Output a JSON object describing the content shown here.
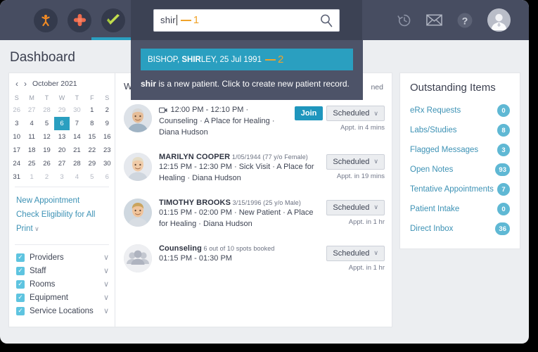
{
  "topbar": {
    "app_icons": [
      {
        "name": "kareo-logo-icon",
        "label": "Kareo"
      },
      {
        "name": "bandage-icon",
        "label": "Clinical"
      },
      {
        "name": "green-check-icon",
        "label": "Billing"
      },
      {
        "name": "heart-patient-icon",
        "label": "Patient Experience"
      }
    ],
    "search": {
      "value": "shir",
      "placeholder": "Search",
      "annotation": "1",
      "icon": "search-icon"
    },
    "right_icons": [
      {
        "name": "history-icon",
        "label": "Recent"
      },
      {
        "name": "mail-icon",
        "label": "Messages"
      },
      {
        "name": "help-icon",
        "label": "Help"
      },
      {
        "name": "user-avatar-icon",
        "label": "Account"
      }
    ]
  },
  "page": {
    "title": "Dashboard"
  },
  "search_dropdown": {
    "result": {
      "prefix": "BISHOP, ",
      "match": "SHIR",
      "suffix": "LEY, 25 Jul 1991",
      "annotation": "2"
    },
    "new_patient_note": {
      "term": "shir",
      "text": " is a new patient. Click to create new patient record."
    }
  },
  "calendar": {
    "prev": "‹",
    "next": "›",
    "month_label": "October 2021",
    "weekdays": [
      "S",
      "M",
      "T",
      "W",
      "T",
      "F",
      "S"
    ],
    "weeks": [
      [
        {
          "d": "26",
          "m": true
        },
        {
          "d": "27",
          "m": true
        },
        {
          "d": "28",
          "m": true
        },
        {
          "d": "29",
          "m": true
        },
        {
          "d": "30",
          "m": true
        },
        {
          "d": "1"
        },
        {
          "d": "2"
        }
      ],
      [
        {
          "d": "3"
        },
        {
          "d": "4"
        },
        {
          "d": "5"
        },
        {
          "d": "6",
          "sel": true
        },
        {
          "d": "7"
        },
        {
          "d": "8"
        },
        {
          "d": "9"
        }
      ],
      [
        {
          "d": "10"
        },
        {
          "d": "11"
        },
        {
          "d": "12"
        },
        {
          "d": "13"
        },
        {
          "d": "14"
        },
        {
          "d": "15"
        },
        {
          "d": "16"
        }
      ],
      [
        {
          "d": "17"
        },
        {
          "d": "18"
        },
        {
          "d": "19"
        },
        {
          "d": "20"
        },
        {
          "d": "21"
        },
        {
          "d": "22"
        },
        {
          "d": "23"
        }
      ],
      [
        {
          "d": "24"
        },
        {
          "d": "25"
        },
        {
          "d": "26"
        },
        {
          "d": "27"
        },
        {
          "d": "28"
        },
        {
          "d": "29"
        },
        {
          "d": "30"
        }
      ],
      [
        {
          "d": "31"
        },
        {
          "d": "1",
          "m": true
        },
        {
          "d": "2",
          "m": true
        },
        {
          "d": "3",
          "m": true
        },
        {
          "d": "4",
          "m": true
        },
        {
          "d": "5",
          "m": true
        },
        {
          "d": "6",
          "m": true
        }
      ]
    ]
  },
  "sidebar": {
    "links": [
      {
        "name": "new-appointment-link",
        "label": "New Appointment",
        "chevron": false
      },
      {
        "name": "check-eligibility-link",
        "label": "Check Eligibility for All",
        "chevron": false
      },
      {
        "name": "print-link",
        "label": "Print",
        "chevron": true
      }
    ],
    "filters": [
      {
        "name": "filter-providers",
        "label": "Providers",
        "checked": true
      },
      {
        "name": "filter-staff",
        "label": "Staff",
        "checked": true
      },
      {
        "name": "filter-rooms",
        "label": "Rooms",
        "checked": true
      },
      {
        "name": "filter-equipment",
        "label": "Equipment",
        "checked": true
      },
      {
        "name": "filter-service-locations",
        "label": "Service Locations",
        "checked": true
      }
    ],
    "chevron": "∨",
    "check": "✓"
  },
  "center": {
    "header_left": "We",
    "header_right": "ned",
    "appointments": [
      {
        "avatar": "patient-photo-older-man",
        "name": "",
        "dob": "",
        "video": true,
        "detail": "12:00 PM - 12:10 PM · Counseling · A Place for Healing · Diana Hudson",
        "join_label": "Join",
        "status_label": "Scheduled",
        "eta": "Appt. in 4 mins"
      },
      {
        "avatar": "patient-photo-woman",
        "name": "MARILYN COOPER",
        "dob": "1/05/1944 (77 y/o Female)",
        "video": false,
        "detail": "12:15 PM - 12:30 PM · Sick Visit · A Place for Healing · Diana Hudson",
        "join_label": "",
        "status_label": "Scheduled",
        "eta": "Appt. in 19 mins"
      },
      {
        "avatar": "patient-photo-young-man",
        "name": "TIMOTHY BROOKS",
        "dob": "3/15/1996 (25 y/o Male)",
        "video": false,
        "detail": "01:15 PM - 02:00 PM · New Patient · A Place for Healing · Diana Hudson",
        "join_label": "",
        "status_label": "Scheduled",
        "eta": "Appt. in 1 hr"
      },
      {
        "avatar": "group-icon",
        "name": "Counseling",
        "dob": "6 out of 10 spots booked",
        "video": false,
        "detail": "01:15 PM - 01:30 PM",
        "join_label": "",
        "status_label": "Scheduled",
        "eta": "Appt. in 1 hr"
      }
    ],
    "status_chevron": "∨"
  },
  "outstanding": {
    "title": "Outstanding Items",
    "items": [
      {
        "label": "eRx Requests",
        "count": "0"
      },
      {
        "label": "Labs/Studies",
        "count": "8"
      },
      {
        "label": "Flagged Messages",
        "count": "3"
      },
      {
        "label": "Open Notes",
        "count": "93"
      },
      {
        "label": "Tentative Appointments",
        "count": "7"
      },
      {
        "label": "Patient Intake",
        "count": "0"
      },
      {
        "label": "Direct Inbox",
        "count": "36"
      }
    ]
  },
  "colors": {
    "topbar": "#474d61",
    "accent_teal": "#2a9fc0",
    "annotation_orange": "#f0a32a",
    "link_blue": "#3d92b5",
    "badge_blue": "#5fb8d4",
    "dropdown_bg": "#4d5368"
  }
}
